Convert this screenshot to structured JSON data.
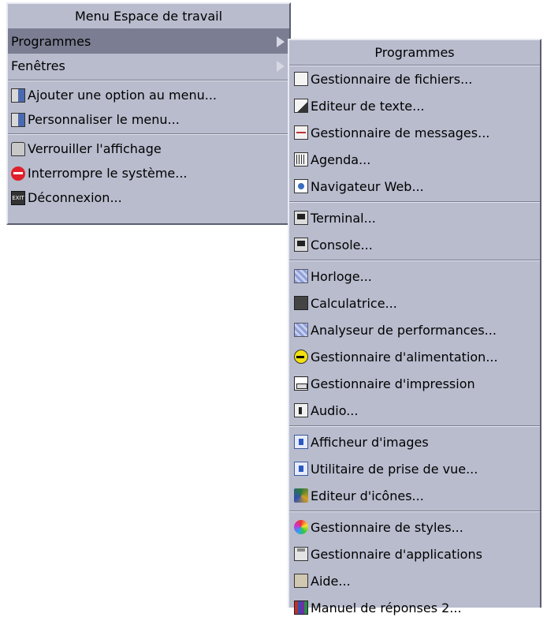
{
  "main_menu": {
    "title": "Menu Espace de travail",
    "items": [
      {
        "label": "Programmes",
        "icon": "none",
        "submenu": true,
        "active": true
      },
      {
        "label": "Fenêtres",
        "icon": "none",
        "submenu": true
      },
      {
        "label": "Ajouter une option au menu...",
        "icon": "menu-edit-icon"
      },
      {
        "label": "Personnaliser le menu...",
        "icon": "menu-edit-icon"
      },
      {
        "label": "Verrouiller l'affichage",
        "icon": "lock-icon"
      },
      {
        "label": "Interrompre le système...",
        "icon": "no-entry-icon"
      },
      {
        "label": "Déconnexion...",
        "icon": "exit-icon"
      }
    ]
  },
  "sub_menu": {
    "title": "Programmes",
    "items": [
      {
        "label": "Gestionnaire de fichiers...",
        "icon": "file-manager-icon"
      },
      {
        "label": "Editeur de texte...",
        "icon": "text-editor-icon"
      },
      {
        "label": "Gestionnaire de messages...",
        "icon": "mail-icon"
      },
      {
        "label": "Agenda...",
        "icon": "calendar-icon"
      },
      {
        "label": "Navigateur Web...",
        "icon": "web-browser-icon"
      },
      {
        "label": "Terminal...",
        "icon": "terminal-icon"
      },
      {
        "label": "Console...",
        "icon": "console-icon"
      },
      {
        "label": "Horloge...",
        "icon": "clock-icon"
      },
      {
        "label": "Calculatrice...",
        "icon": "calculator-icon"
      },
      {
        "label": "Analyseur de performances...",
        "icon": "performance-icon"
      },
      {
        "label": "Gestionnaire d'alimentation...",
        "icon": "power-icon"
      },
      {
        "label": "Gestionnaire d'impression",
        "icon": "printer-icon"
      },
      {
        "label": "Audio...",
        "icon": "audio-icon"
      },
      {
        "label": "Afficheur d'images",
        "icon": "image-viewer-icon"
      },
      {
        "label": "Utilitaire de prise de vue...",
        "icon": "snapshot-icon"
      },
      {
        "label": "Editeur d'icônes...",
        "icon": "icon-editor-icon"
      },
      {
        "label": "Gestionnaire de styles...",
        "icon": "style-manager-icon"
      },
      {
        "label": "Gestionnaire d'applications",
        "icon": "app-manager-icon"
      },
      {
        "label": "Aide...",
        "icon": "help-icon"
      },
      {
        "label": "Manuel de réponses 2...",
        "icon": "answerbook-icon"
      }
    ]
  }
}
